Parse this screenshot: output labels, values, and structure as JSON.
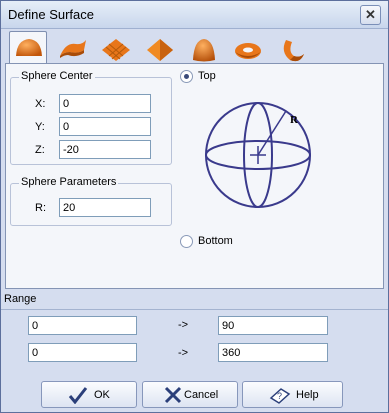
{
  "window": {
    "title": "Define Surface",
    "close": "✕"
  },
  "tabs": [
    {
      "name": "sphere",
      "active": true
    },
    {
      "name": "cylinder",
      "active": false
    },
    {
      "name": "plane",
      "active": false
    },
    {
      "name": "cone",
      "active": false
    },
    {
      "name": "paraboloid",
      "active": false
    },
    {
      "name": "torus",
      "active": false
    },
    {
      "name": "spiral",
      "active": false
    }
  ],
  "sphere_center": {
    "label": "Sphere Center",
    "x_label": "X:",
    "x_value": "0",
    "y_label": "Y:",
    "y_value": "0",
    "z_label": "Z:",
    "z_value": "-20"
  },
  "sphere_params": {
    "label": "Sphere Parameters",
    "r_label": "R:",
    "r_value": "20"
  },
  "orientation": {
    "top_label": "Top",
    "top_checked": true,
    "bottom_label": "Bottom",
    "bottom_checked": false,
    "diagram_label": "R"
  },
  "range": {
    "label": "Range",
    "row1": {
      "from": "0",
      "arrow": "->",
      "to": "90"
    },
    "row2": {
      "from": "0",
      "arrow": "->",
      "to": "360"
    }
  },
  "buttons": {
    "ok": "OK",
    "cancel": "Cancel",
    "help": "Help"
  },
  "colors": {
    "accent": "#e8761a",
    "diagram": "#3a3a8c",
    "window_bg": "#d5ddef"
  }
}
